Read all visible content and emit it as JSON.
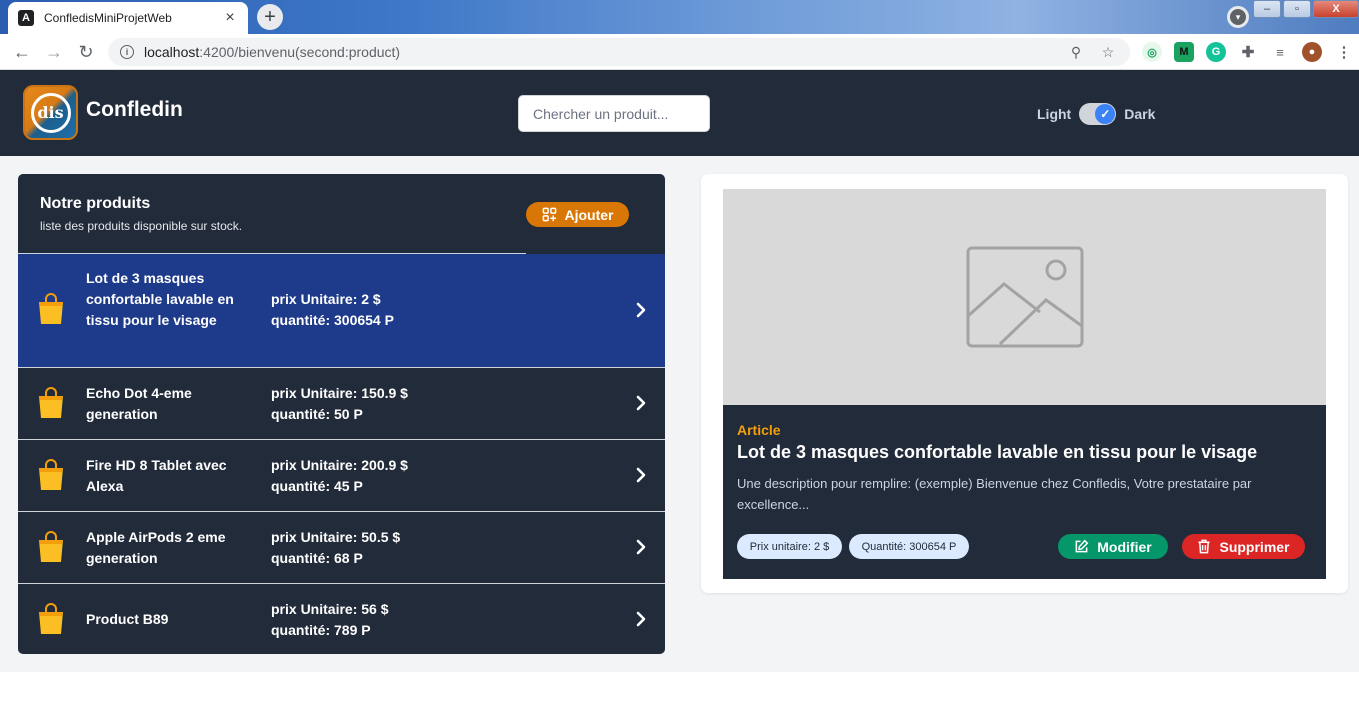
{
  "browser": {
    "tab_title": "ConfledisMiniProjetWeb",
    "tab_favicon": "angular-icon",
    "url_host": "localhost",
    "url_rest": ":4200/bienvenu(second:product)"
  },
  "header": {
    "brand": "Confledin",
    "search_placeholder": "Chercher un produit...",
    "theme_light": "Light",
    "theme_dark": "Dark",
    "theme_dark_on": true
  },
  "list": {
    "title": "Notre produits",
    "subtitle": "liste des produits disponible sur stock.",
    "add_label": "Ajouter",
    "products": [
      {
        "name": "Lot de 3 masques confortable lavable en tissu pour le visage",
        "price": "prix Unitaire: 2 $",
        "qty": "quantité: 300654 P",
        "active": true
      },
      {
        "name": "Echo Dot 4-eme generation",
        "price": "prix Unitaire: 150.9 $",
        "qty": "quantité: 50 P",
        "active": false
      },
      {
        "name": "Fire HD 8 Tablet avec Alexa",
        "price": "prix Unitaire: 200.9 $",
        "qty": "quantité: 45 P",
        "active": false
      },
      {
        "name": "Apple AirPods 2 eme generation",
        "price": "prix Unitaire: 50.5 $",
        "qty": "quantité: 68 P",
        "active": false
      },
      {
        "name": "Product B89",
        "price": "prix Unitaire: 56 $",
        "qty": "quantité: 789 P",
        "active": false
      }
    ]
  },
  "detail": {
    "category": "Article",
    "title": "Lot de 3 masques confortable lavable en tissu pour le visage",
    "description": "Une description pour remplire: (exemple) Bienvenue chez Confledis, Votre prestataire par excellence...",
    "price_pill": "Prix unitaire: 2 $",
    "qty_pill": "Quantité: 300654 P",
    "edit_label": "Modifier",
    "delete_label": "Supprimer"
  },
  "colors": {
    "header_bg": "#222b3a",
    "active_row": "#1e3a8a",
    "accent_orange": "#d97706",
    "edit_green": "#059669",
    "delete_red": "#dc2626"
  }
}
